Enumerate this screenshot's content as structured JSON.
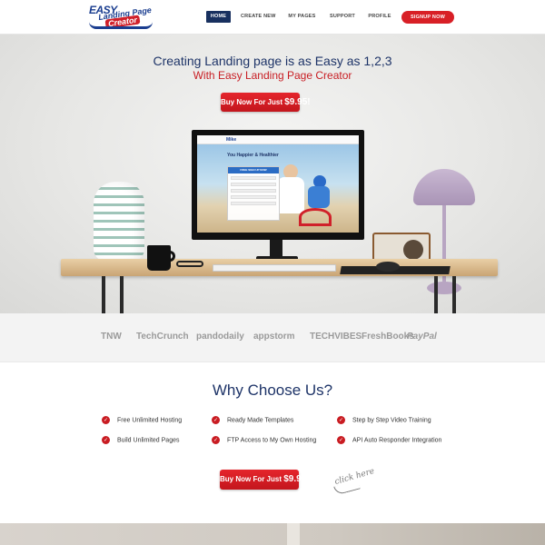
{
  "header": {
    "logo": {
      "line1": "EASY",
      "line2": "Landing Page",
      "line3": "Creator"
    },
    "nav": [
      {
        "label": "HOME",
        "active": true
      },
      {
        "label": "CREATE NEW",
        "active": false
      },
      {
        "label": "MY PAGES",
        "active": false
      },
      {
        "label": "SUPPORT",
        "active": false
      },
      {
        "label": "PROFILE",
        "active": false
      }
    ],
    "signup_label": "SIGNUP NOW"
  },
  "hero": {
    "title": "Creating Landing page is as Easy as 1,2,3",
    "subtitle": "With Easy Landing Page Creator",
    "buy_label": "Buy Now For Just",
    "buy_price": "$9.95!",
    "screen": {
      "logo": "Mike",
      "headline": "You Happier & Healthier",
      "form_head": "FREE SIGN UP NOW"
    }
  },
  "logos": [
    "TNW",
    "TechCrunch",
    "pandodaily",
    "appstorm",
    "TECHVIBES",
    "FreshBooks",
    "PayPal"
  ],
  "why": {
    "title": "Why Choose Us?",
    "features": [
      "Free Unlimited Hosting",
      "Ready Made Templates",
      "Step by Step Video Training",
      "Build Unlimited Pages",
      "FTP Access to My Own Hosting",
      "API Auto Responder Integration"
    ],
    "buy_label": "Buy Now For Just",
    "buy_price": "$9.95!",
    "click_here": "click here"
  },
  "colors": {
    "brand_navy": "#1e3468",
    "brand_red": "#d81f26",
    "nav_active_bg": "#18305f"
  },
  "icons": {
    "feature_check": "check-icon"
  }
}
